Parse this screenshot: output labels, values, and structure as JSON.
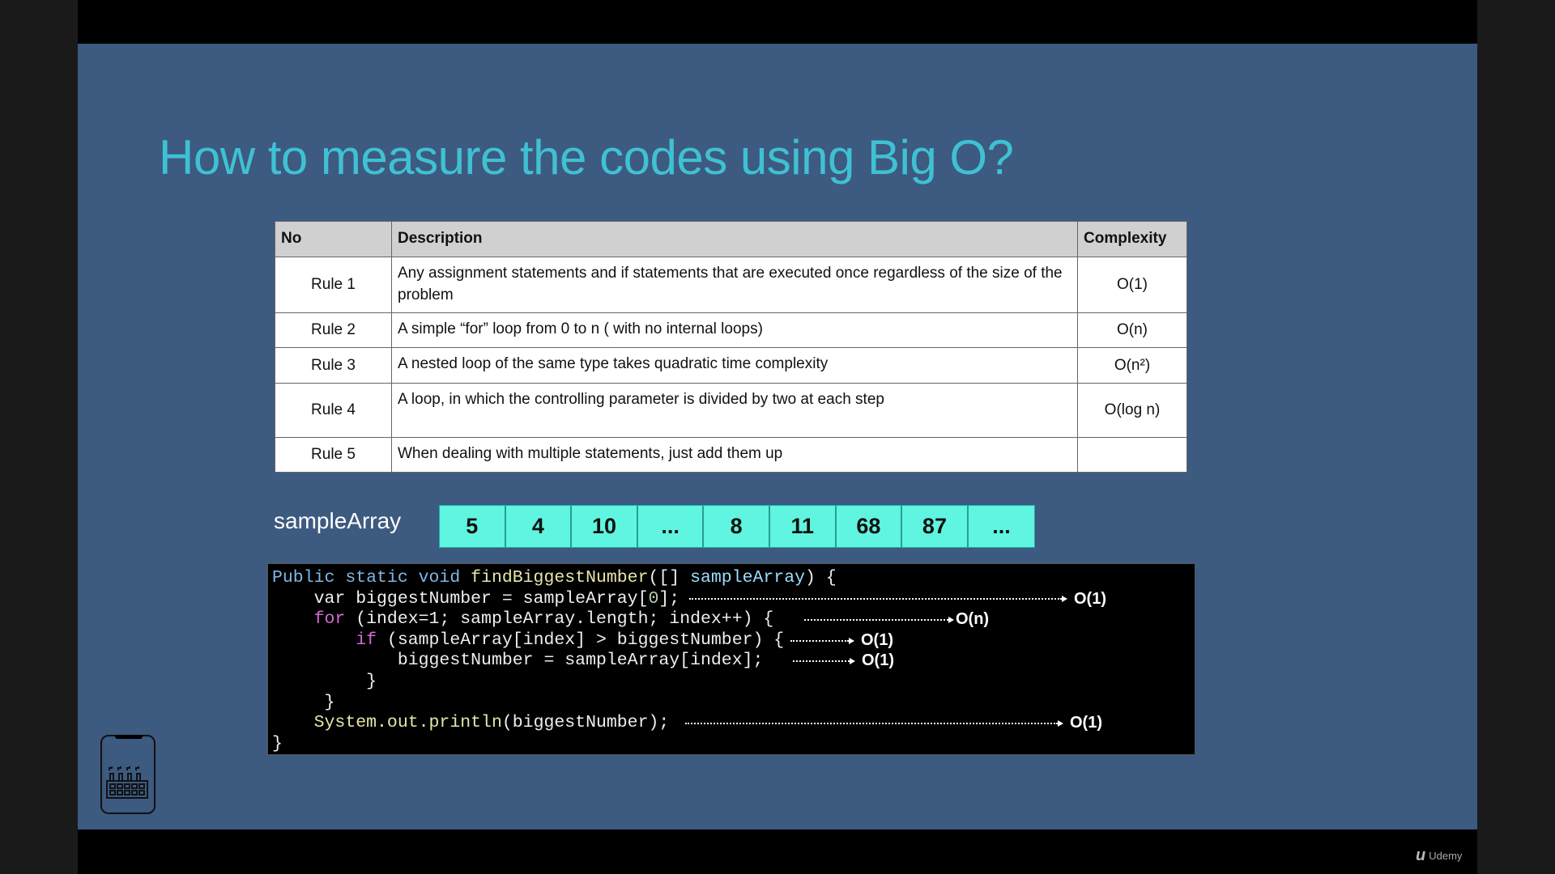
{
  "slide": {
    "title": "How to measure the codes using Big O?",
    "table": {
      "headers": [
        "No",
        "Description",
        "Complexity"
      ],
      "rows": [
        {
          "no": "Rule 1",
          "description": "Any assignment statements and if statements that are executed once regardless of the size of the problem",
          "complexity": "O(1)"
        },
        {
          "no": "Rule 2",
          "description": "A simple “for” loop from 0 to n ( with no internal loops)",
          "complexity": "O(n)"
        },
        {
          "no": "Rule 3",
          "description": "A nested loop of the same type takes quadratic time complexity",
          "complexity": "O(n²)"
        },
        {
          "no": "Rule 4",
          "description": "A loop, in which the controlling parameter is divided by two at each step",
          "complexity": "O(log n)"
        },
        {
          "no": "Rule 5",
          "description": "When dealing with multiple statements, just add them up",
          "complexity": ""
        }
      ]
    },
    "array_label": "sampleArray",
    "array_values": [
      "5",
      "4",
      "10",
      "...",
      "8",
      "11",
      "68",
      "87",
      "..."
    ],
    "array_color": "#5ff5e0",
    "title_color": "#3fc1d3",
    "background_color": "#3d5a80",
    "code": {
      "l1": {
        "a": "Public static void ",
        "b": "findBiggestNumber",
        "c": "([] ",
        "d": "sampleArray",
        "e": ") {"
      },
      "l2": {
        "a": "    var biggestNumber = sampleArray[",
        "b": "0",
        "c": "];",
        "ann": "O(1)"
      },
      "l3": {
        "a": "    ",
        "b": "for",
        "c": " (index=1; sampleArray.length; index++) {",
        "ann": "O(n)"
      },
      "l4": {
        "a": "        ",
        "b": "if",
        "c": " (sampleArray[index] > biggestNumber) {",
        "ann": "O(1)"
      },
      "l5": {
        "a": "            biggestNumber = sampleArray[index];",
        "ann": "O(1)"
      },
      "l6": "         }",
      "l7": "     }",
      "l8": {
        "a": "    ",
        "b": "System.out.println",
        "c": "(biggestNumber);",
        "ann": "O(1)"
      },
      "l9": "}"
    }
  },
  "branding": {
    "logo_text": "Udemy",
    "logo_mark": "ṻ"
  },
  "icons": {
    "phone": "phone-factory-icon"
  }
}
